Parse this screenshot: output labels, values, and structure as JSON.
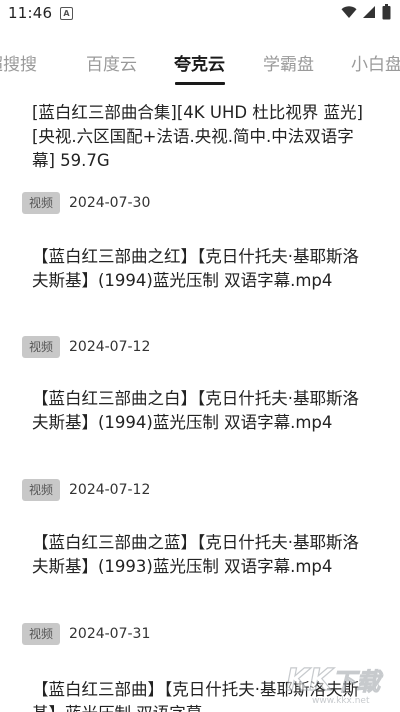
{
  "status_bar": {
    "time": "11:46",
    "icons": [
      "a-notification-icon",
      "wifi-icon",
      "cell-signal-icon",
      "battery-icon"
    ]
  },
  "tabs": [
    {
      "label": "超搜搜",
      "active": false
    },
    {
      "label": "百度云",
      "active": false
    },
    {
      "label": "夸克云",
      "active": true
    },
    {
      "label": "学霸盘",
      "active": false
    },
    {
      "label": "小白盘",
      "active": false
    }
  ],
  "results": [
    {
      "title": "[蓝白红三部曲合集][4K UHD 杜比视界 蓝光][央视.六区国配+法语.央视.简中.中法双语字幕] 59.7G",
      "badge": "视频",
      "date": "2024-07-30"
    },
    {
      "title": "【蓝白红三部曲之红】【克日什托夫·基耶斯洛夫斯基】(1994)蓝光压制 双语字幕.mp4",
      "badge": "视频",
      "date": "2024-07-12"
    },
    {
      "title": "【蓝白红三部曲之白】【克日什托夫·基耶斯洛夫斯基】(1994)蓝光压制 双语字幕.mp4",
      "badge": "视频",
      "date": "2024-07-12"
    },
    {
      "title": "【蓝白红三部曲之蓝】【克日什托夫·基耶斯洛夫斯基】(1993)蓝光压制 双语字幕.mp4",
      "badge": "视频",
      "date": "2024-07-31"
    },
    {
      "title": "【蓝白红三部曲】【克日什托夫·基耶斯洛夫斯基】蓝光压制 双语字幕",
      "badge": "",
      "date": ""
    }
  ],
  "watermark": {
    "text": "KK下载",
    "url": "www.kkx.net"
  },
  "colors": {
    "tab_active": "#1a1a1a",
    "tab_inactive": "#9a9a9a",
    "badge_bg": "#c8c8c8",
    "text": "#222222"
  }
}
